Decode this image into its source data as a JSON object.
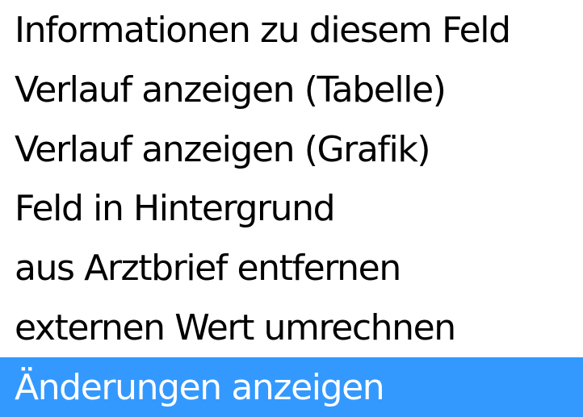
{
  "context_menu": {
    "items": [
      {
        "label": "Informationen zu diesem Feld",
        "selected": false
      },
      {
        "label": "Verlauf anzeigen (Tabelle)",
        "selected": false
      },
      {
        "label": "Verlauf anzeigen (Grafik)",
        "selected": false
      },
      {
        "label": "Feld in Hintergrund",
        "selected": false
      },
      {
        "label": "aus Arztbrief entfernen",
        "selected": false
      },
      {
        "label": "externen Wert umrechnen",
        "selected": false
      },
      {
        "label": "Änderungen anzeigen",
        "selected": true
      }
    ],
    "colors": {
      "background": "#ffffff",
      "text": "#000000",
      "highlight_background": "#3399ff",
      "highlight_text": "#ffffff"
    }
  }
}
